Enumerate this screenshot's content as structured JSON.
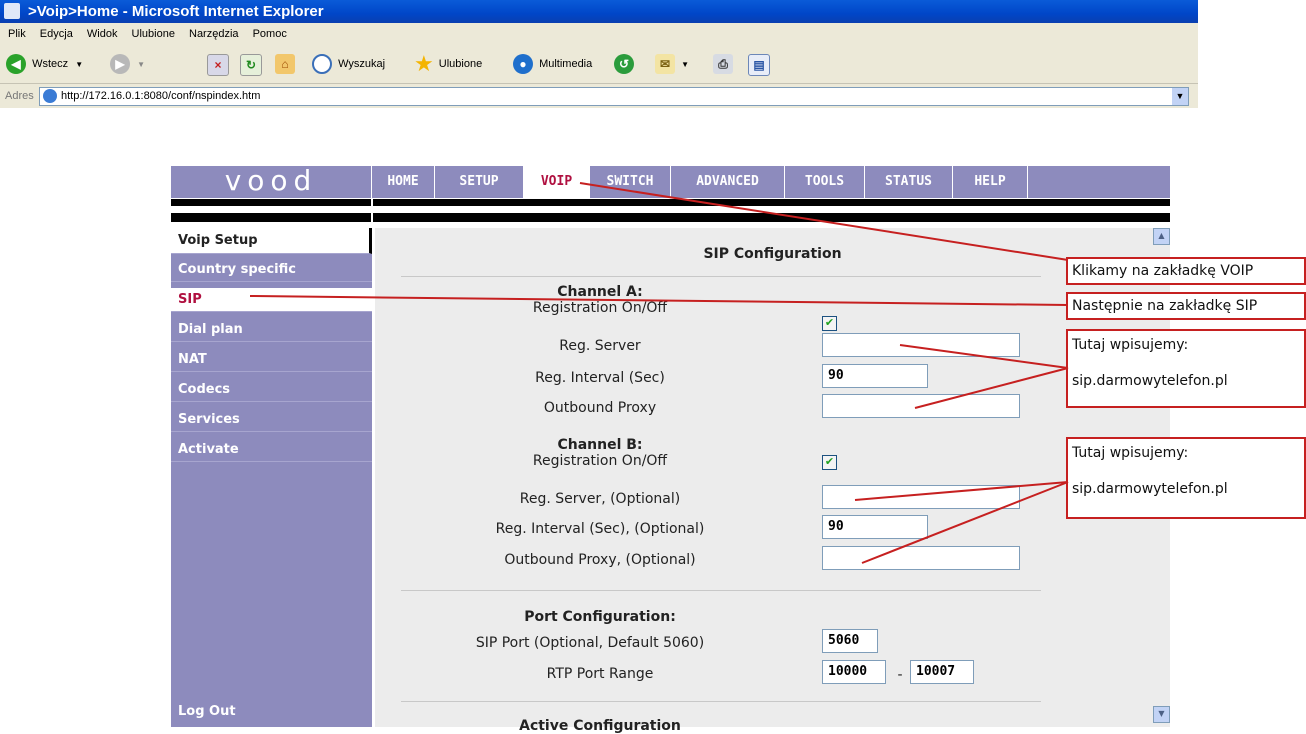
{
  "browser": {
    "title": ">Voip>Home - Microsoft Internet Explorer",
    "menu": [
      "Plik",
      "Edycja",
      "Widok",
      "Ulubione",
      "Narzędzia",
      "Pomoc"
    ],
    "toolbar": {
      "back": "Wstecz",
      "search": "Wyszukaj",
      "favorites": "Ulubione",
      "media": "Multimedia"
    },
    "address_label": "Adres",
    "address_url": "http://172.16.0.1:8080/conf/nspindex.htm"
  },
  "router": {
    "logo": "vood",
    "nav": [
      "HOME",
      "SETUP",
      "VOIP",
      "SWITCH",
      "ADVANCED",
      "TOOLS",
      "STATUS",
      "HELP"
    ],
    "active_nav": "VOIP",
    "sidebar_header": "Voip Setup",
    "sidebar_items": [
      "Country specific",
      "SIP",
      "Dial plan",
      "NAT",
      "Codecs",
      "Services",
      "Activate"
    ],
    "active_sidebar": "SIP",
    "logout": "Log Out"
  },
  "sip": {
    "title": "SIP Configuration",
    "channel_a": {
      "heading": "Channel A:",
      "registration_label": "Registration On/Off",
      "registration_checked": true,
      "server_label": "Reg. Server",
      "server_value": "",
      "interval_label": "Reg. Interval (Sec)",
      "interval_value": "90",
      "proxy_label": "Outbound Proxy",
      "proxy_value": ""
    },
    "channel_b": {
      "heading": "Channel B:",
      "registration_label": "Registration On/Off",
      "registration_checked": true,
      "server_label": "Reg. Server, (Optional)",
      "server_value": "",
      "interval_label": "Reg. Interval (Sec), (Optional)",
      "interval_value": "90",
      "proxy_label": "Outbound Proxy, (Optional)",
      "proxy_value": ""
    },
    "port": {
      "heading": "Port Configuration:",
      "sip_port_label": "SIP Port (Optional, Default 5060)",
      "sip_port_value": "5060",
      "rtp_label": "RTP Port Range",
      "rtp_from": "10000",
      "rtp_dash": "-",
      "rtp_to": "10007"
    },
    "next_section_partial": "Active Configuration"
  },
  "annotations": {
    "note1": "Klikamy na zakładkę VOIP",
    "note2": "Następnie na zakładkę SIP",
    "note3_line1": "Tutaj wpisujemy:",
    "note3_line2": "sip.darmowytelefon.pl",
    "note4_line1": "Tutaj wpisujemy:",
    "note4_line2": "sip.darmowytelefon.pl",
    "line_color": "#c62020"
  }
}
